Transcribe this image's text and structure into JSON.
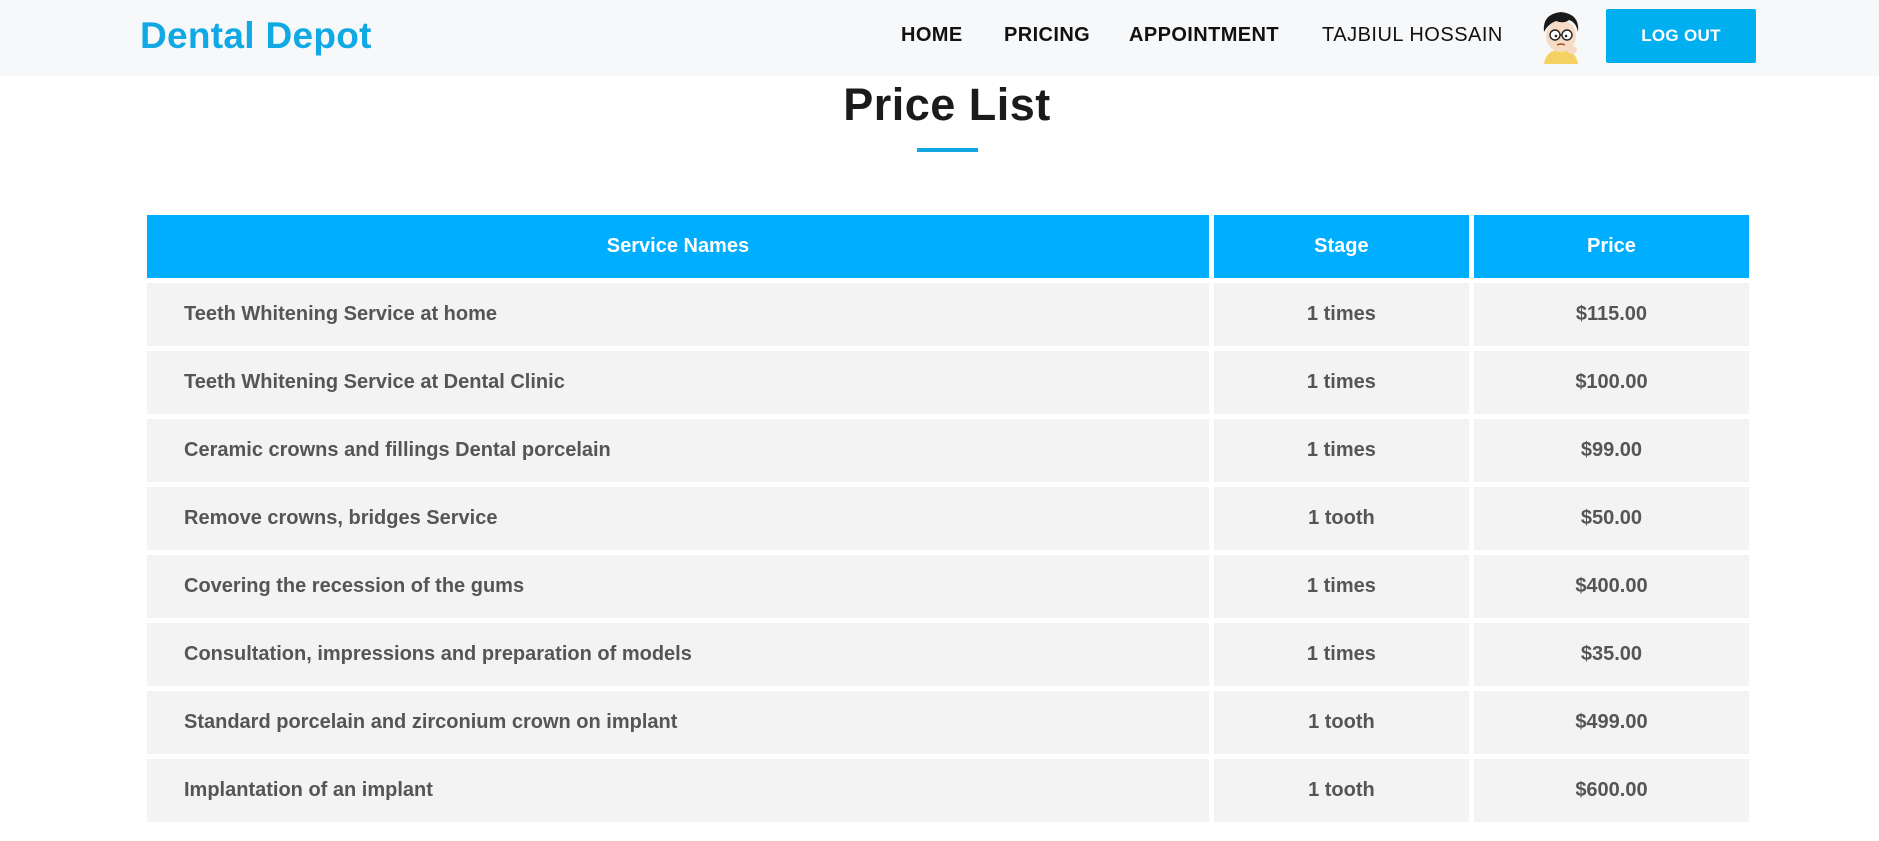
{
  "brand": "Dental Depot",
  "nav": {
    "home": "HOME",
    "pricing": "PRICING",
    "appointment": "APPOINTMENT",
    "user": "TAJBIUL HOSSAIN",
    "logout": "LOG OUT"
  },
  "page": {
    "title": "Price List"
  },
  "table": {
    "headers": [
      "Service Names",
      "Stage",
      "Price"
    ],
    "rows": [
      {
        "service": "Teeth Whitening Service at home",
        "stage": "1 times",
        "price": "$115.00"
      },
      {
        "service": "Teeth Whitening Service at Dental Clinic",
        "stage": "1 times",
        "price": "$100.00"
      },
      {
        "service": "Ceramic crowns and fillings Dental porcelain",
        "stage": "1 times",
        "price": "$99.00"
      },
      {
        "service": "Remove crowns, bridges Service",
        "stage": "1 tooth",
        "price": "$50.00"
      },
      {
        "service": "Covering the recession of the gums",
        "stage": "1 times",
        "price": "$400.00"
      },
      {
        "service": "Consultation, impressions and preparation of models",
        "stage": "1 times",
        "price": "$35.00"
      },
      {
        "service": "Standard porcelain and zirconium crown on implant",
        "stage": "1 tooth",
        "price": "$499.00"
      },
      {
        "service": "Implantation of an implant",
        "stage": "1 tooth",
        "price": "$600.00"
      }
    ]
  },
  "colors": {
    "brand": "#10a9e6",
    "accent": "#00aeff",
    "row_bg": "#f3f3f3"
  },
  "icons": {
    "avatar": "cartoon-boy-avatar"
  }
}
